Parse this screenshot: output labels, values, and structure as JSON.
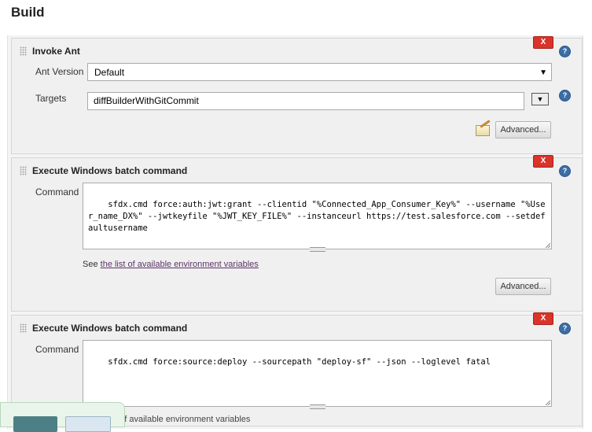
{
  "section": {
    "title": "Build"
  },
  "invoke_ant": {
    "title": "Invoke Ant",
    "delete_label": "X",
    "help_label": "?",
    "ant_version_label": "Ant Version",
    "ant_version_value": "Default",
    "targets_label": "Targets",
    "targets_value": "diffBuilderWithGitCommit",
    "expand_label": "▼",
    "advanced_label": "Advanced..."
  },
  "batch_1": {
    "title": "Execute Windows batch command",
    "delete_label": "X",
    "help_label": "?",
    "command_label": "Command",
    "command_value": "sfdx.cmd force:auth:jwt:grant --clientid \"%Connected_App_Consumer_Key%\" --username \"%User_name_DX%\" --jwtkeyfile \"%JWT_KEY_FILE%\" --instanceurl https://test.salesforce.com --setdefaultusername",
    "see_prefix": "See",
    "env_link": "the list of available environment variables",
    "advanced_label": "Advanced..."
  },
  "batch_2": {
    "title": "Execute Windows batch command",
    "delete_label": "X",
    "help_label": "?",
    "command_label": "Command",
    "command_value": "sfdx.cmd force:source:deploy --sourcepath \"deploy-sf\" --json --loglevel fatal",
    "partial_text": "t of available environment variables"
  },
  "colors": {
    "delete": "#d9332b",
    "help": "#3a6ea5",
    "link": "#5c3566"
  }
}
